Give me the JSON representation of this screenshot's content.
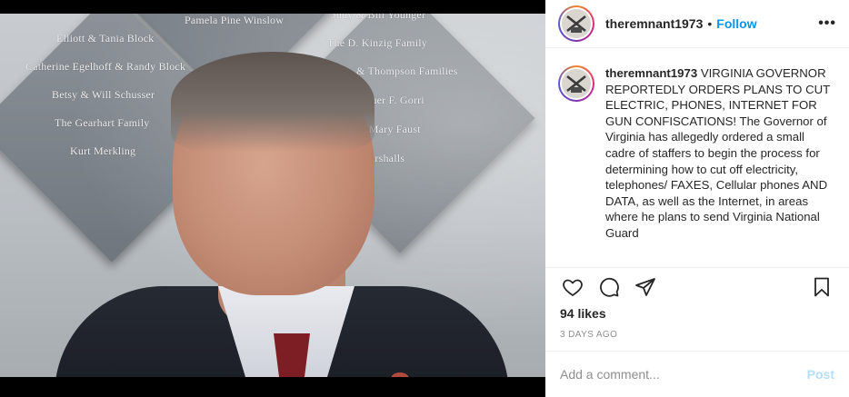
{
  "post": {
    "image": {
      "plaques": [
        "Pamela Pine Winslow",
        "Elliott & Tania Block",
        "Catherine Egelhoff & Randy Block",
        "Betsy & Will Schusser",
        "The Gearhart Family",
        "Kurt Merkling",
        "Judy & Bill Younger",
        "The D. Kinzig Family",
        "& Thompson Families",
        "opher F. Gorri",
        "& Mary Faust",
        "Marshalls"
      ]
    },
    "header": {
      "username": "theremnant1973",
      "separator": "•",
      "follow_label": "Follow",
      "more_label": "•••"
    },
    "caption": {
      "username": "theremnant1973",
      "text": "VIRGINIA GOVERNOR REPORTEDLY ORDERS PLANS TO CUT ELECTRIC, PHONES, INTERNET FOR GUN CONFISCATIONS! The Governor of Virginia has allegedly ordered a small cadre of staffers to begin the process for determining how to cut off electricity, telephones/ FAXES, Cellular phones AND DATA, as well as the Internet, in areas where he plans to send Virginia National Guard"
    },
    "actions": {
      "like_icon": "heart-icon",
      "comment_icon": "comment-icon",
      "share_icon": "paper-plane-icon",
      "save_icon": "bookmark-icon"
    },
    "likes": "94 likes",
    "timestamp": "3 DAYS AGO",
    "comment": {
      "placeholder": "Add a comment...",
      "post_label": "Post"
    }
  },
  "colors": {
    "link": "#0095f6",
    "post_disabled": "#b2dffc",
    "muted": "#8e8e8e"
  }
}
